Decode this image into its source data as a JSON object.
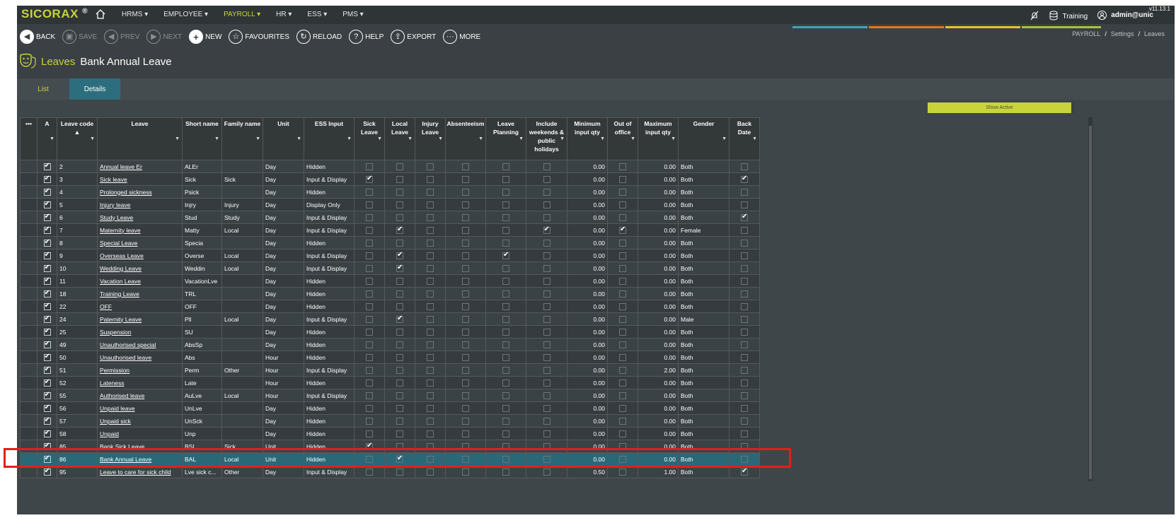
{
  "app": {
    "logo": "SICORAX",
    "logo_reg": "®",
    "version": "v11.13.1",
    "nav": [
      "HRMS ▾",
      "EMPLOYEE ▾",
      "PAYROLL ▾",
      "HR ▾",
      "ESS ▾",
      "PMS ▾"
    ],
    "active_nav": "PAYROLL ▾",
    "training_label": "Training",
    "user_label": "admin@unic"
  },
  "toolbar": {
    "back": "BACK",
    "save": "SAVE",
    "prev": "PREV",
    "next": "NEXT",
    "new": "NEW",
    "favourites": "FAVOURITES",
    "reload": "RELOAD",
    "help": "HELP",
    "export": "EXPORT",
    "more": "MORE"
  },
  "breadcrumb": {
    "b1": "PAYROLL",
    "b2": "Settings",
    "b3": "Leaves",
    "sep": "/"
  },
  "title": {
    "module": "Leaves",
    "record": "Bank Annual Leave"
  },
  "tabs": {
    "list": "List",
    "details": "Details"
  },
  "show_active": "Show Active",
  "colors": {
    "accent": "#c8d43a",
    "selected_row": "#2a6878",
    "highlight": "#e0201c",
    "bar1": "#3aa6b9",
    "bar2": "#e3781e",
    "bar3": "#e9c42a",
    "bar4": "#a6c43a"
  },
  "columns": [
    "•••",
    "A",
    "Leave code ▲",
    "Leave",
    "Short name",
    "Family name",
    "Unit",
    "ESS Input",
    "Sick Leave",
    "Local Leave",
    "Injury Leave",
    "Absenteeism",
    "Leave Planning",
    "Include weekends & public holidays",
    "Minimum input qty",
    "Out of office",
    "Maximum input qty",
    "Gender",
    "Back Date"
  ],
  "rows": [
    {
      "code": "2",
      "leave": "Annual leave Er",
      "short": "ALEr",
      "family": "",
      "unit": "Day",
      "ess": "Hidden",
      "sick": false,
      "local": false,
      "weekends": false,
      "min": "0.00",
      "out": false,
      "max": "0.00",
      "gender": "Both",
      "back": false,
      "planning": false,
      "link": true
    },
    {
      "code": "3",
      "leave": "Sick leave",
      "short": "Sick",
      "family": "Sick",
      "unit": "Day",
      "ess": "Input & Display",
      "sick": true,
      "local": false,
      "weekends": false,
      "min": "0.00",
      "out": false,
      "max": "0.00",
      "gender": "Both",
      "back": true,
      "planning": false,
      "link": true
    },
    {
      "code": "4",
      "leave": "Prolonged sickness",
      "short": "Psick",
      "family": "",
      "unit": "Day",
      "ess": "Hidden",
      "sick": false,
      "local": false,
      "weekends": false,
      "min": "0.00",
      "out": false,
      "max": "0.00",
      "gender": "Both",
      "back": false,
      "planning": false,
      "link": true
    },
    {
      "code": "5",
      "leave": "Injury leave",
      "short": "Injry",
      "family": "Injury",
      "unit": "Day",
      "ess": "Display Only",
      "sick": false,
      "local": false,
      "weekends": false,
      "min": "0.00",
      "out": false,
      "max": "0.00",
      "gender": "Both",
      "back": false,
      "planning": false,
      "link": true
    },
    {
      "code": "6",
      "leave": "Study Leave",
      "short": "Stud",
      "family": "Study",
      "unit": "Day",
      "ess": "Input & Display",
      "sick": false,
      "local": false,
      "weekends": false,
      "min": "0.00",
      "out": false,
      "max": "0.00",
      "gender": "Both",
      "back": true,
      "planning": false,
      "link": true
    },
    {
      "code": "7",
      "leave": "Maternity leave",
      "short": "Matty",
      "family": "Local",
      "unit": "Day",
      "ess": "Input & Display",
      "sick": false,
      "local": true,
      "weekends": true,
      "min": "0.00",
      "out": true,
      "max": "0.00",
      "gender": "Female",
      "back": false,
      "planning": false,
      "link": true
    },
    {
      "code": "8",
      "leave": "Special Leave",
      "short": "Specia",
      "family": "",
      "unit": "Day",
      "ess": "Hidden",
      "sick": false,
      "local": false,
      "weekends": false,
      "min": "0.00",
      "out": false,
      "max": "0.00",
      "gender": "Both",
      "back": false,
      "planning": false,
      "link": true
    },
    {
      "code": "9",
      "leave": "Overseas Leave",
      "short": "Overse",
      "family": "Local",
      "unit": "Day",
      "ess": "Input & Display",
      "sick": false,
      "local": true,
      "weekends": false,
      "min": "0.00",
      "out": false,
      "max": "0.00",
      "gender": "Both",
      "back": false,
      "planning": true,
      "link": true
    },
    {
      "code": "10",
      "leave": "Wedding Leave",
      "short": "Weddin",
      "family": "Local",
      "unit": "Day",
      "ess": "Input & Display",
      "sick": false,
      "local": true,
      "weekends": false,
      "min": "0.00",
      "out": false,
      "max": "0.00",
      "gender": "Both",
      "back": false,
      "planning": false,
      "link": true
    },
    {
      "code": "11",
      "leave": "Vacation Leave",
      "short": "VacationLve",
      "family": "",
      "unit": "Day",
      "ess": "Hidden",
      "sick": false,
      "local": false,
      "weekends": false,
      "min": "0.00",
      "out": false,
      "max": "0.00",
      "gender": "Both",
      "back": false,
      "planning": false,
      "link": true
    },
    {
      "code": "18",
      "leave": "Training Leave",
      "short": "TRL",
      "family": "",
      "unit": "Day",
      "ess": "Hidden",
      "sick": false,
      "local": false,
      "weekends": false,
      "min": "0.00",
      "out": false,
      "max": "0.00",
      "gender": "Both",
      "back": false,
      "planning": false,
      "link": true
    },
    {
      "code": "22",
      "leave": "OFF",
      "short": "OFF",
      "family": "",
      "unit": "Day",
      "ess": "Hidden",
      "sick": false,
      "local": false,
      "weekends": false,
      "min": "0.00",
      "out": false,
      "max": "0.00",
      "gender": "Both",
      "back": false,
      "planning": false,
      "link": true
    },
    {
      "code": "24",
      "leave": "Paternity Leave",
      "short": "Pll",
      "family": "Local",
      "unit": "Day",
      "ess": "Input & Display",
      "sick": false,
      "local": true,
      "weekends": false,
      "min": "0.00",
      "out": false,
      "max": "0.00",
      "gender": "Male",
      "back": false,
      "planning": false,
      "link": true
    },
    {
      "code": "25",
      "leave": "Suspension",
      "short": "SU",
      "family": "",
      "unit": "Day",
      "ess": "Hidden",
      "sick": false,
      "local": false,
      "weekends": false,
      "min": "0.00",
      "out": false,
      "max": "0.00",
      "gender": "Both",
      "back": false,
      "planning": false,
      "link": true
    },
    {
      "code": "49",
      "leave": "Unauthorised special",
      "short": "AbsSp",
      "family": "",
      "unit": "Day",
      "ess": "Hidden",
      "sick": false,
      "local": false,
      "weekends": false,
      "min": "0.00",
      "out": false,
      "max": "0.00",
      "gender": "Both",
      "back": false,
      "planning": false,
      "link": true
    },
    {
      "code": "50",
      "leave": "Unauthorised leave",
      "short": "Abs",
      "family": "",
      "unit": "Hour",
      "ess": "Hidden",
      "sick": false,
      "local": false,
      "weekends": false,
      "min": "0.00",
      "out": false,
      "max": "0.00",
      "gender": "Both",
      "back": false,
      "planning": false,
      "link": true
    },
    {
      "code": "51",
      "leave": "Permission",
      "short": "Perm",
      "family": "Other",
      "unit": "Hour",
      "ess": "Input & Display",
      "sick": false,
      "local": false,
      "weekends": false,
      "min": "0.00",
      "out": false,
      "max": "2.00",
      "gender": "Both",
      "back": false,
      "planning": false,
      "link": true
    },
    {
      "code": "52",
      "leave": "Lateness",
      "short": "Late",
      "family": "",
      "unit": "Hour",
      "ess": "Hidden",
      "sick": false,
      "local": false,
      "weekends": false,
      "min": "0.00",
      "out": false,
      "max": "0.00",
      "gender": "Both",
      "back": false,
      "planning": false,
      "link": true
    },
    {
      "code": "55",
      "leave": "Authorised leave",
      "short": "AuLve",
      "family": "Local",
      "unit": "Hour",
      "ess": "Input & Display",
      "sick": false,
      "local": false,
      "weekends": false,
      "min": "0.00",
      "out": false,
      "max": "0.00",
      "gender": "Both",
      "back": false,
      "planning": false,
      "link": true
    },
    {
      "code": "56",
      "leave": "Unpaid leave",
      "short": "UnLve",
      "family": "",
      "unit": "Day",
      "ess": "Hidden",
      "sick": false,
      "local": false,
      "weekends": false,
      "min": "0.00",
      "out": false,
      "max": "0.00",
      "gender": "Both",
      "back": false,
      "planning": false,
      "link": true
    },
    {
      "code": "57",
      "leave": "Unpaid sick",
      "short": "UnSck",
      "family": "",
      "unit": "Day",
      "ess": "Hidden",
      "sick": false,
      "local": false,
      "weekends": false,
      "min": "0.00",
      "out": false,
      "max": "0.00",
      "gender": "Both",
      "back": false,
      "planning": false,
      "link": true
    },
    {
      "code": "58",
      "leave": "Unpaid",
      "short": "Unp",
      "family": "",
      "unit": "Day",
      "ess": "Hidden",
      "sick": false,
      "local": false,
      "weekends": false,
      "min": "0.00",
      "out": false,
      "max": "0.00",
      "gender": "Both",
      "back": false,
      "planning": false,
      "link": true
    },
    {
      "code": "85",
      "leave": "Bank Sick Leave",
      "short": "BSL",
      "family": "Sick",
      "unit": "Unit",
      "ess": "Hidden",
      "sick": true,
      "local": false,
      "weekends": false,
      "min": "0.00",
      "out": false,
      "max": "0.00",
      "gender": "Both",
      "back": false,
      "planning": false,
      "link": false
    },
    {
      "code": "86",
      "leave": "Bank Annual Leave",
      "short": "BAL",
      "family": "Local",
      "unit": "Unit",
      "ess": "Hidden",
      "sick": false,
      "local": true,
      "weekends": false,
      "min": "0.00",
      "out": false,
      "max": "0.00",
      "gender": "Both",
      "back": false,
      "planning": false,
      "link": true,
      "selected": true
    },
    {
      "code": "95",
      "leave": "Leave to care for sick child",
      "short": "Lve sick c...",
      "family": "Other",
      "unit": "Day",
      "ess": "Input & Display",
      "sick": false,
      "local": false,
      "weekends": false,
      "min": "0.50",
      "out": false,
      "max": "1.00",
      "gender": "Both",
      "back": true,
      "planning": false,
      "link": true
    }
  ]
}
